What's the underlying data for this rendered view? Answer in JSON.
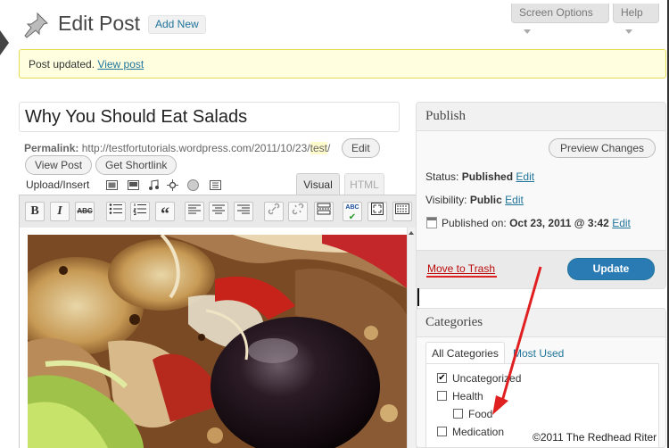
{
  "header": {
    "title": "Edit Post",
    "add_new": "Add New",
    "screen_options": "Screen Options",
    "help": "Help"
  },
  "notice": {
    "text": "Post updated.",
    "link": "View post"
  },
  "post": {
    "title_value": "Why You Should Eat Salads",
    "permalink_label": "Permalink:",
    "permalink_base": "http://testfortutorials.wordpress.com/2011/10/23/",
    "permalink_slug": "test",
    "permalink_end": "/",
    "edit_button": "Edit",
    "view_post": "View Post",
    "get_shortlink": "Get Shortlink",
    "upload_insert": "Upload/Insert",
    "tab_visual": "Visual",
    "tab_html": "HTML"
  },
  "toolbar": {
    "bold": "B",
    "italic": "I",
    "strike": "ABC",
    "quote": "“",
    "spellcheck": "ABC"
  },
  "publish": {
    "heading": "Publish",
    "preview": "Preview Changes",
    "status_label": "Status:",
    "status_value": "Published",
    "status_edit": "Edit",
    "visibility_label": "Visibility:",
    "visibility_value": "Public",
    "visibility_edit": "Edit",
    "published_label": "Published on:",
    "published_value": "Oct 23, 2011 @ 3:42",
    "published_edit": "Edit",
    "trash": "Move to Trash",
    "update": "Update"
  },
  "categories": {
    "heading": "Categories",
    "tab_all": "All Categories",
    "tab_used": "Most Used",
    "items": [
      {
        "label": "Uncategorized",
        "checked": true
      },
      {
        "label": "Health",
        "checked": false
      },
      {
        "label": "Food",
        "checked": false
      },
      {
        "label": "Medication",
        "checked": false
      }
    ]
  },
  "watermark": "©2011 The Redhead Riter",
  "colors": {
    "link": "#21759b",
    "update_button": "#2a7bb4",
    "notice_bg": "#ffffe0",
    "trash": "#bc0b0b",
    "annotation_arrow": "#e02020"
  }
}
